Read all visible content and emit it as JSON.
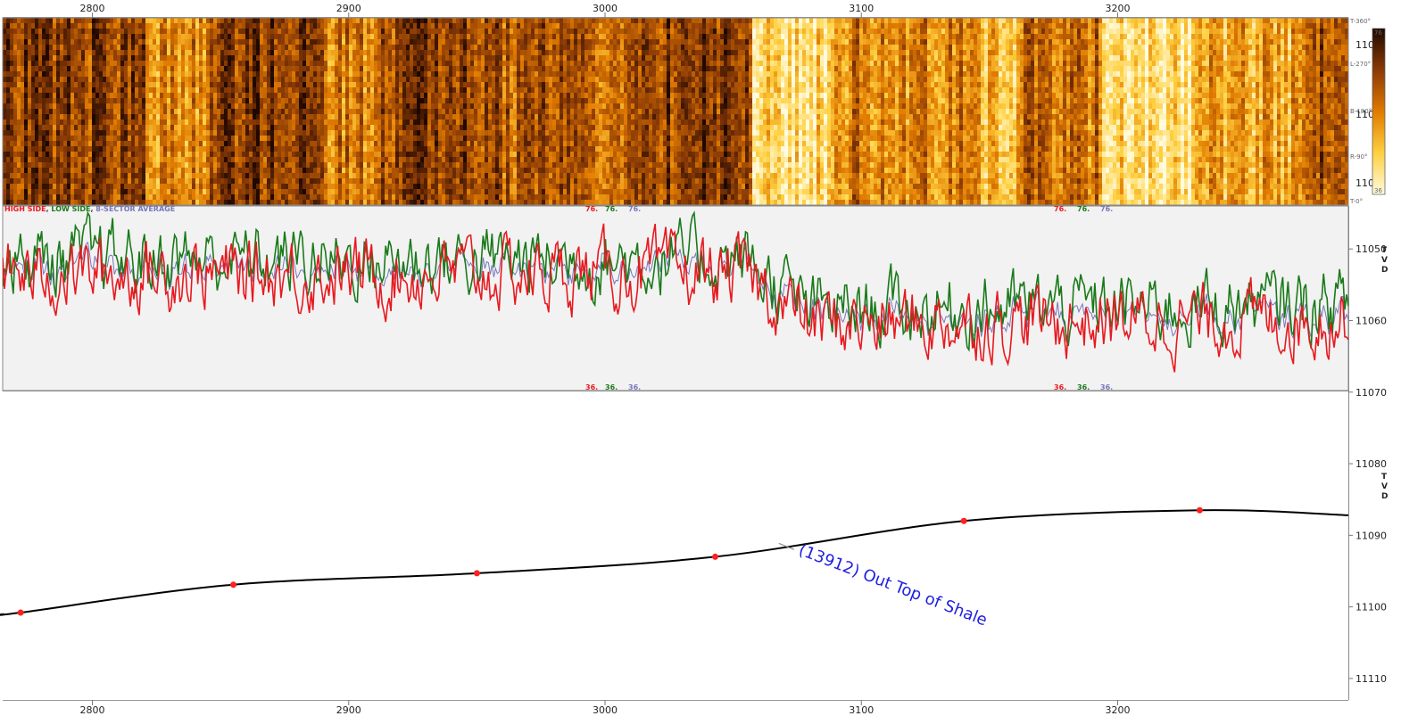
{
  "colors": {
    "high_side": "#e8191f",
    "low_side": "#1a7a1a",
    "sector_average": "#7777bb",
    "trajectory": "#000000",
    "marker": "#ff2020",
    "annotation": "#1f1fe0",
    "log_panel_bg": "#f2f2f2"
  },
  "chart_data": [
    {
      "type": "heatmap",
      "title": "",
      "x_range": [
        2765,
        3290
      ],
      "colorbar": {
        "min": "36",
        "max": "76",
        "colors": [
          "#fffbe0",
          "#ffd040",
          "#e07a00",
          "#8a3a05",
          "#1f0800"
        ]
      },
      "right_labels": [
        "T-360°",
        "L-270°",
        "B-180°",
        "R-90°",
        "T-0°"
      ],
      "right_ticks": [
        "110",
        "110",
        "110"
      ]
    },
    {
      "type": "line",
      "title": "",
      "x_range": [
        2765,
        3290
      ],
      "y_range": [
        36,
        76
      ],
      "legend": {
        "high_side": "HIGH SIDE",
        "sep1": ", ",
        "low_side": "LOW SIDE",
        "sep2": ", ",
        "avg": "8-SECTOR AVERAGE"
      },
      "scale_top": [
        "76.",
        "76.",
        "76."
      ],
      "scale_bottom": [
        "36.",
        "36.",
        "36."
      ],
      "series": [
        {
          "name": "HIGH SIDE",
          "color": "#e8191f"
        },
        {
          "name": "LOW SIDE",
          "color": "#1a7a1a"
        },
        {
          "name": "8-SECTOR AVERAGE",
          "color": "#7777bb"
        }
      ]
    },
    {
      "type": "line",
      "title": "",
      "xlabel": "",
      "ylabel": "TVD",
      "x_ticks": [
        2800,
        2900,
        3000,
        3100,
        3200
      ],
      "x_tick_labels": [
        "2800",
        "2900",
        "3000",
        "3100",
        "3200"
      ],
      "y_ticks": [
        11050,
        11060,
        11070,
        11080,
        11090,
        11100,
        11110
      ],
      "y_tick_labels": [
        "11050",
        "11060",
        "11070",
        "11080",
        "11090",
        "11100",
        "11110"
      ],
      "xlim": [
        2765,
        3290
      ],
      "ylim": [
        11044,
        11113
      ],
      "series": [
        {
          "name": "",
          "x": [
            2765,
            2772,
            2855,
            2950,
            3043,
            3140,
            3232,
            3290
          ],
          "y": [
            11101.0,
            11100.8,
            11096.9,
            11095.3,
            11093.0,
            11088.0,
            11086.5,
            11087.2
          ]
        }
      ],
      "markers": {
        "x": [
          2772,
          2855,
          2950,
          3043,
          3140,
          3232
        ],
        "y": [
          11100.8,
          11096.9,
          11095.3,
          11093.0,
          11088.0,
          11086.5
        ]
      },
      "annotation": {
        "text": "(13912) Out Top of Shale",
        "x": 3072,
        "y": 11091.5
      }
    }
  ]
}
